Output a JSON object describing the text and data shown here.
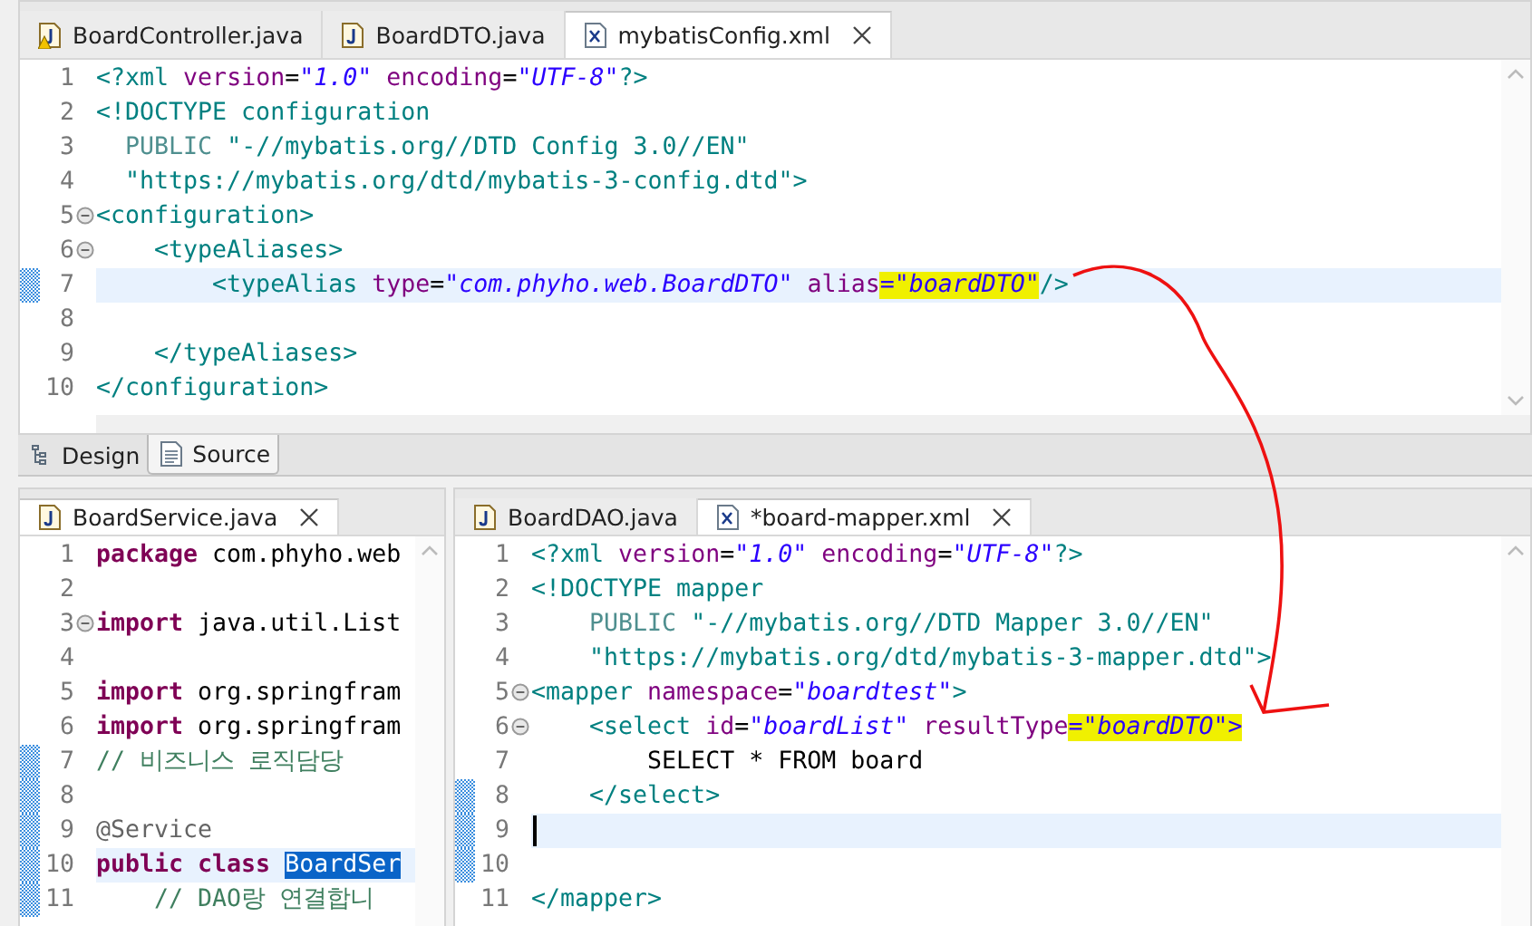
{
  "top_editor": {
    "tabs": [
      {
        "label": "BoardController.java",
        "kind": "java-warning",
        "selected": false,
        "closable": false
      },
      {
        "label": "BoardDTO.java",
        "kind": "java",
        "selected": false,
        "closable": false
      },
      {
        "label": "mybatisConfig.xml",
        "kind": "xml",
        "selected": true,
        "closable": true
      }
    ],
    "lines": [
      {
        "num": "1",
        "fold": false,
        "changed": false,
        "current": false,
        "tokens": [
          {
            "kind": "tag",
            "text": "<?xml "
          },
          {
            "kind": "attr",
            "text": "version"
          },
          {
            "kind": "plain",
            "text": "="
          },
          {
            "kind": "str",
            "text": "\"1.0\""
          },
          {
            "kind": "attr",
            "text": " encoding"
          },
          {
            "kind": "plain",
            "text": "="
          },
          {
            "kind": "str",
            "text": "\"UTF-8\""
          },
          {
            "kind": "tag",
            "text": "?>"
          }
        ]
      },
      {
        "num": "2",
        "fold": false,
        "changed": false,
        "current": false,
        "tokens": [
          {
            "kind": "tag",
            "text": "<!DOCTYPE configuration"
          }
        ]
      },
      {
        "num": "3",
        "fold": false,
        "changed": false,
        "current": false,
        "tokens": [
          {
            "kind": "dim",
            "text": "  PUBLIC "
          },
          {
            "kind": "tag",
            "text": "\"-//mybatis.org//DTD Config 3.0//EN\""
          }
        ]
      },
      {
        "num": "4",
        "fold": false,
        "changed": false,
        "current": false,
        "tokens": [
          {
            "kind": "tag",
            "text": "  \"https://mybatis.org/dtd/mybatis-3-config.dtd\">"
          }
        ]
      },
      {
        "num": "5",
        "fold": true,
        "changed": false,
        "current": false,
        "tokens": [
          {
            "kind": "tag",
            "text": "<configuration>"
          }
        ]
      },
      {
        "num": "6",
        "fold": true,
        "changed": false,
        "current": false,
        "tokens": [
          {
            "kind": "tag",
            "text": "    <typeAliases>"
          }
        ]
      },
      {
        "num": "7",
        "fold": false,
        "changed": true,
        "current": true,
        "tokens": [
          {
            "kind": "tag",
            "text": "        <typeAlias "
          },
          {
            "kind": "attr",
            "text": "type"
          },
          {
            "kind": "plain",
            "text": "="
          },
          {
            "kind": "str",
            "text": "\"com.phyho.web.BoardDTO\""
          },
          {
            "kind": "attr",
            "text": " alias"
          },
          {
            "kind": "marked",
            "text": "=\"boardDTO\""
          },
          {
            "kind": "tag",
            "text": "/>"
          }
        ]
      },
      {
        "num": "8",
        "fold": false,
        "changed": false,
        "current": false
      },
      {
        "num": "9",
        "fold": false,
        "changed": false,
        "current": false,
        "tokens": [
          {
            "kind": "tag",
            "text": "    </typeAliases>"
          }
        ]
      },
      {
        "num": "10",
        "fold": false,
        "changed": false,
        "current": false,
        "tokens": [
          {
            "kind": "tag",
            "text": "</configuration>"
          }
        ]
      }
    ]
  },
  "view_tabs": [
    {
      "label": "Design",
      "kind": "design",
      "selected": false
    },
    {
      "label": "Source",
      "kind": "source",
      "selected": true
    }
  ],
  "left_editor": {
    "tabs": [
      {
        "label": "BoardService.java",
        "kind": "java",
        "selected": true,
        "closable": true
      }
    ],
    "lines": [
      {
        "num": "1",
        "fold": false,
        "changed": false,
        "current": false,
        "tokens": [
          {
            "kind": "kw",
            "text": "package"
          },
          {
            "kind": "plain",
            "text": " com.phyho.web"
          }
        ]
      },
      {
        "num": "2",
        "fold": false,
        "changed": false,
        "current": false
      },
      {
        "num": "3",
        "fold": true,
        "changed": false,
        "current": false,
        "tokens": [
          {
            "kind": "kw",
            "text": "import"
          },
          {
            "kind": "plain",
            "text": " java.util.List"
          }
        ]
      },
      {
        "num": "4",
        "fold": false,
        "changed": false,
        "current": false
      },
      {
        "num": "5",
        "fold": false,
        "changed": false,
        "current": false,
        "tokens": [
          {
            "kind": "kw",
            "text": "import"
          },
          {
            "kind": "plain",
            "text": " org.springfram"
          }
        ]
      },
      {
        "num": "6",
        "fold": false,
        "changed": false,
        "current": false,
        "tokens": [
          {
            "kind": "kw",
            "text": "import"
          },
          {
            "kind": "plain",
            "text": " org.springfram"
          }
        ]
      },
      {
        "num": "7",
        "fold": false,
        "changed": true,
        "current": false,
        "tokens": [
          {
            "kind": "comment",
            "text": "// 비즈니스 로직담당"
          }
        ]
      },
      {
        "num": "8",
        "fold": false,
        "changed": true,
        "current": false
      },
      {
        "num": "9",
        "fold": false,
        "changed": true,
        "current": false,
        "tokens": [
          {
            "kind": "annotation",
            "text": "@Service"
          }
        ]
      },
      {
        "num": "10",
        "fold": false,
        "changed": true,
        "current": true,
        "tokens": [
          {
            "kind": "kw",
            "text": "public class "
          },
          {
            "kind": "selection",
            "text": "BoardSer"
          }
        ]
      },
      {
        "num": "11",
        "fold": false,
        "changed": true,
        "current": false,
        "tokens": [
          {
            "kind": "comment",
            "text": "    // DAO랑 연결합니"
          }
        ]
      }
    ]
  },
  "right_editor": {
    "tabs": [
      {
        "label": "BoardDAO.java",
        "kind": "java",
        "selected": false,
        "closable": false
      },
      {
        "label": "*board-mapper.xml",
        "kind": "xml",
        "selected": true,
        "closable": true
      }
    ],
    "lines": [
      {
        "num": "1",
        "fold": false,
        "changed": false,
        "current": false,
        "tokens": [
          {
            "kind": "tag",
            "text": "<?xml "
          },
          {
            "kind": "attr",
            "text": "version"
          },
          {
            "kind": "plain",
            "text": "="
          },
          {
            "kind": "str",
            "text": "\"1.0\""
          },
          {
            "kind": "attr",
            "text": " encoding"
          },
          {
            "kind": "plain",
            "text": "="
          },
          {
            "kind": "str",
            "text": "\"UTF-8\""
          },
          {
            "kind": "tag",
            "text": "?>"
          }
        ]
      },
      {
        "num": "2",
        "fold": false,
        "changed": false,
        "current": false,
        "tokens": [
          {
            "kind": "tag",
            "text": "<!DOCTYPE mapper"
          }
        ]
      },
      {
        "num": "3",
        "fold": false,
        "changed": false,
        "current": false,
        "tokens": [
          {
            "kind": "dim",
            "text": "    PUBLIC "
          },
          {
            "kind": "tag",
            "text": "\"-//mybatis.org//DTD Mapper 3.0//EN\""
          }
        ]
      },
      {
        "num": "4",
        "fold": false,
        "changed": false,
        "current": false,
        "tokens": [
          {
            "kind": "tag",
            "text": "    \"https://mybatis.org/dtd/mybatis-3-mapper.dtd\">"
          }
        ]
      },
      {
        "num": "5",
        "fold": true,
        "changed": false,
        "current": false,
        "tokens": [
          {
            "kind": "tag",
            "text": "<mapper "
          },
          {
            "kind": "attr",
            "text": "namespace"
          },
          {
            "kind": "plain",
            "text": "="
          },
          {
            "kind": "str",
            "text": "\"boardtest\""
          },
          {
            "kind": "tag",
            "text": ">"
          }
        ]
      },
      {
        "num": "6",
        "fold": true,
        "changed": false,
        "current": false,
        "tokens": [
          {
            "kind": "tag",
            "text": "    <select "
          },
          {
            "kind": "attr",
            "text": "id"
          },
          {
            "kind": "plain",
            "text": "="
          },
          {
            "kind": "str",
            "text": "\"boardList\""
          },
          {
            "kind": "attr",
            "text": " resultType"
          },
          {
            "kind": "marked",
            "text": "=\"boardDTO\">"
          }
        ]
      },
      {
        "num": "7",
        "fold": false,
        "changed": false,
        "current": false,
        "tokens": [
          {
            "kind": "plain",
            "text": "        SELECT * FROM board"
          }
        ]
      },
      {
        "num": "8",
        "fold": false,
        "changed": true,
        "current": false,
        "tokens": [
          {
            "kind": "tag",
            "text": "    </select>"
          }
        ]
      },
      {
        "num": "9",
        "fold": false,
        "changed": true,
        "current": true
      },
      {
        "num": "10",
        "fold": false,
        "changed": true,
        "current": false
      },
      {
        "num": "11",
        "fold": false,
        "changed": false,
        "current": false,
        "tokens": [
          {
            "kind": "tag",
            "text": "</mapper>"
          }
        ]
      }
    ]
  }
}
